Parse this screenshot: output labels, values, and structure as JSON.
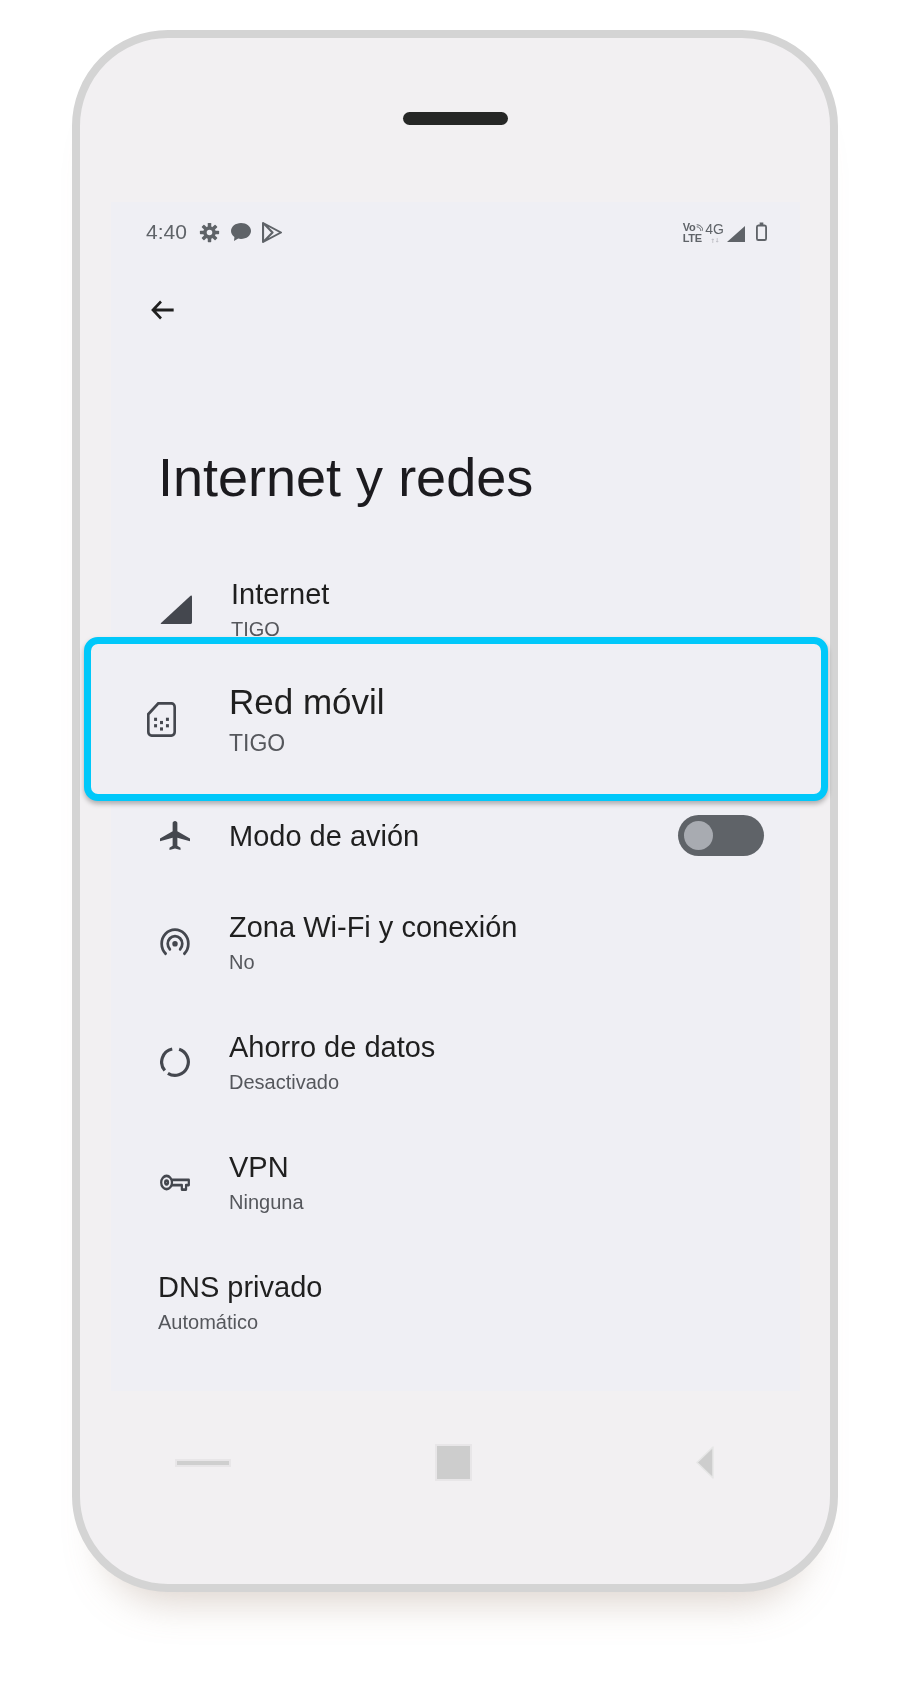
{
  "status_bar": {
    "time": "4:40",
    "volte_top": "Vo",
    "volte_bottom": "LTE",
    "network": "4G"
  },
  "header": {
    "title": "Internet y redes"
  },
  "items": [
    {
      "kind": "entry",
      "title": "Internet",
      "summary": "TIGO",
      "highlighted": false
    },
    {
      "kind": "entry",
      "title": "Red móvil",
      "summary": "TIGO",
      "highlighted": true
    },
    {
      "kind": "switch",
      "title": "Modo de avión",
      "on": false,
      "highlighted": false
    },
    {
      "kind": "entry",
      "title": "Zona Wi-Fi y conexión",
      "summary": "No",
      "highlighted": false
    },
    {
      "kind": "entry",
      "title": "Ahorro de datos",
      "summary": "Desactivado",
      "highlighted": false
    },
    {
      "kind": "entry",
      "title": "VPN",
      "summary": "Ninguna",
      "highlighted": false
    },
    {
      "kind": "entry",
      "title": "DNS privado",
      "summary": "Automático",
      "highlighted": false
    }
  ]
}
